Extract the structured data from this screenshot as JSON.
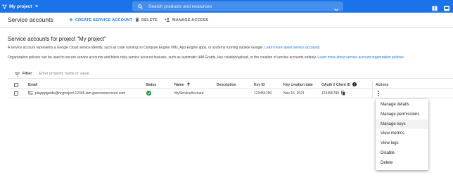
{
  "topbar": {
    "project": "My project",
    "search_placeholder": "Search products and resources"
  },
  "actionbar": {
    "title": "Service accounts",
    "create_label": "CREATE SERVICE ACCOUNT",
    "delete_label": "DELETE",
    "manage_access_label": "MANAGE ACCESS"
  },
  "main": {
    "heading": "Service accounts for project \"My project\"",
    "desc1": "A service account represents a Google Cloud service identity, such as code running on Compute Engine VMs, App Engine apps, or systems running outside Google.",
    "desc1_link": "Learn more about service accounts.",
    "desc2": "Organization policies can be used to secure service accounts and block risky service account features, such as automatic IAM Grants, key creation/upload, or the creation of service accounts entirely.",
    "desc2_link": "Learn more about service account organization policies."
  },
  "filter": {
    "label": "Filter",
    "placeholder": "Enter property name or value"
  },
  "table": {
    "headers": {
      "email": "Email",
      "status": "Status",
      "name": "Name",
      "description": "Description",
      "key_id": "Key ID",
      "key_date": "Key creation date",
      "oauth": "OAuth 2 Client ID",
      "actions": "Actions"
    },
    "rows": [
      {
        "email": "playippguide@myproject-12345.iam.gserviceaccount.com",
        "status": "enabled",
        "name": "MyServiceAccount",
        "description": "",
        "key_id": "123456789",
        "key_date": "Nov 15, 2021",
        "oauth": "123456789"
      }
    ]
  },
  "menu": {
    "items": [
      "Manage details",
      "Manage permissions",
      "Manage keys",
      "View metrics",
      "View logs",
      "Disable",
      "Delete"
    ],
    "highlighted": "Manage keys"
  },
  "colors": {
    "primary": "#1a73e8",
    "success": "#1e8e3e",
    "text": "#202124",
    "muted": "#5f6368"
  },
  "icons": [
    "project-icon",
    "search-icon",
    "chevron-down-icon",
    "help-icon",
    "notifications-icon",
    "add-icon",
    "trash-icon",
    "person-add-icon",
    "filter-icon",
    "service-account-icon",
    "check-circle-icon",
    "arrow-up-icon",
    "help-circle-icon",
    "copy-icon",
    "more-vert-icon"
  ]
}
